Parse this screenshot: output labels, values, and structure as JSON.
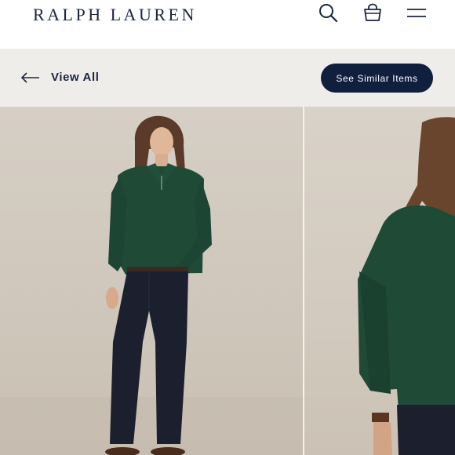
{
  "header": {
    "brand": "RALPH LAUREN",
    "icons": [
      "search-icon",
      "shopping-bag-icon",
      "menu-icon"
    ]
  },
  "subnav": {
    "back_label": "View All",
    "similar_label": "See Similar Items"
  },
  "gallery": {
    "images": [
      "model-front-photo",
      "model-side-photo"
    ]
  },
  "colors": {
    "navy": "#0f1f3d",
    "brand_text": "#1a2540",
    "subnav_bg": "#efedea",
    "sweater_green": "#1f4a36",
    "jeans": "#1b1f2e"
  }
}
